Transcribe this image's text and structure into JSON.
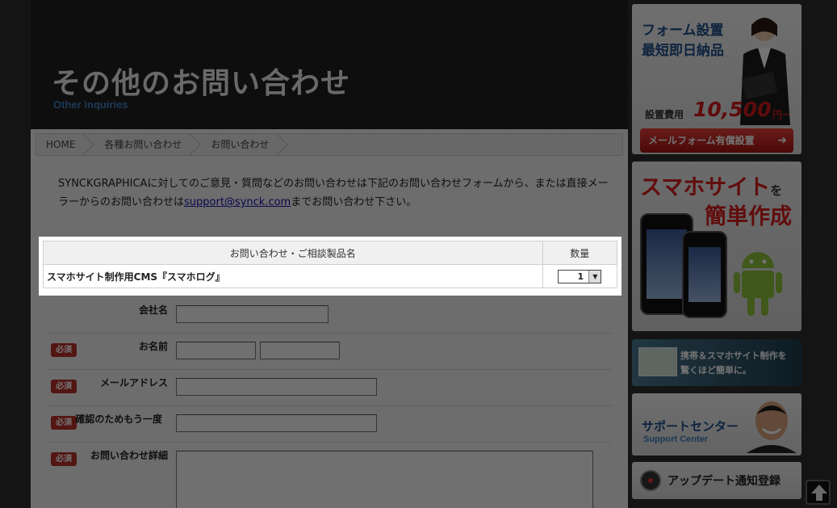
{
  "hero": {
    "title": "その他のお問い合わせ",
    "subtitle": "Other inquiries"
  },
  "breadcrumb": [
    "HOME",
    "各種お問い合わせ",
    "お問い合わせ"
  ],
  "intro": {
    "before": "SYNCKGRAPHICAに対してのご意見・質問などのお問い合わせは下記のお問い合わせフォームから、または直接メーラーからのお問い合わせは",
    "email": "support@synck.com",
    "after": "までお問い合わせ下さい。"
  },
  "product_table": {
    "headers": [
      "お問い合わせ・ご相談製品名",
      "数量"
    ],
    "product": "スマホサイト制作用CMS『スマホログ』",
    "quantity": "1"
  },
  "form": {
    "required_label": "必須",
    "fields": [
      "会社名",
      "お名前",
      "メールアドレス",
      "確認のためもう一度",
      "お問い合わせ詳細"
    ]
  },
  "sidebar": {
    "banner1": {
      "line1": "フォーム設置",
      "line2": "最短即日納品",
      "fee_label": "設置費用",
      "price": "10,500",
      "yen": "円~",
      "button": "メールフォーム有償設置"
    },
    "banner2": {
      "line1": "スマホサイト",
      "wo": "を",
      "line2": "簡単作成"
    },
    "banner3": {
      "line1": "携帯＆スマホサイト制作を",
      "line2": "驚くほど簡単に。"
    },
    "banner4": {
      "line1": "サポートセンター",
      "line2": "Support Center"
    },
    "banner5": {
      "label": "アップデート通知登録"
    }
  }
}
